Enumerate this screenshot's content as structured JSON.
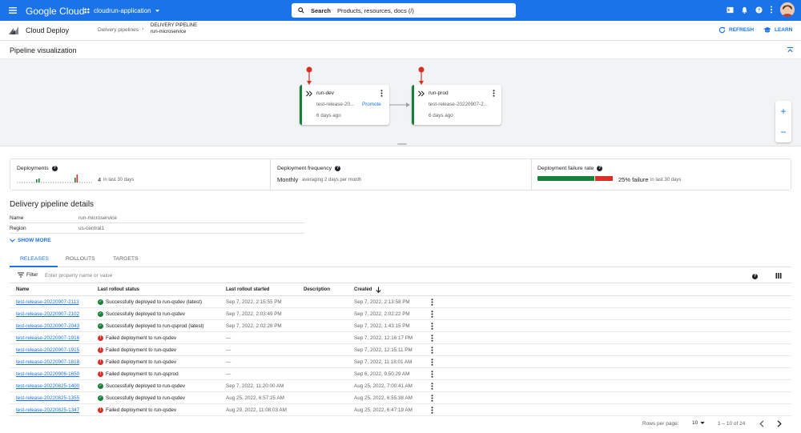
{
  "topbar": {
    "logo": "Google Cloud",
    "project": "cloudrun-application",
    "search_label": "Search",
    "search_placeholder": "Products, resources, docs (/)"
  },
  "header": {
    "product": "Cloud Deploy",
    "breadcrumb_parent": "Delivery pipelines",
    "breadcrumb_type": "DELIVERY PIPELINE",
    "breadcrumb_name": "run-microservice",
    "refresh": "REFRESH",
    "learn": "LEARN"
  },
  "viz": {
    "title": "Pipeline visualization",
    "stages": [
      {
        "name": "run-dev",
        "release": "test-release-20...",
        "ago": "6 days ago",
        "promote": "Promote"
      },
      {
        "name": "run-prod",
        "release": "test-release-20220907-2...",
        "ago": "6 days ago"
      }
    ],
    "zoom_in": "+",
    "zoom_out": "−"
  },
  "stats": {
    "deployments_label": "Deployments",
    "deployments_count": "4",
    "deployments_period": "in last 30 days",
    "frequency_label": "Deployment frequency",
    "frequency_value": "Monthly",
    "frequency_note": "averaging 2 days per month",
    "failure_label": "Deployment failure rate",
    "failure_value": "25% failure",
    "failure_period": "in last 30 days",
    "failure_rate": 0.25,
    "colors": {
      "success": "#188038",
      "failure": "#d93025"
    }
  },
  "details": {
    "title": "Delivery pipeline details",
    "name_key": "Name",
    "name_value": "run-microservice",
    "region_key": "Region",
    "region_value": "us-central1",
    "show_more": "SHOW MORE"
  },
  "tabs": [
    "RELEASES",
    "ROLLOUTS",
    "TARGETS"
  ],
  "filter": {
    "label": "Filter",
    "placeholder": "Enter property name or value"
  },
  "table": {
    "headers": {
      "name": "Name",
      "status": "Last rollout status",
      "started": "Last rollout started",
      "description": "Description",
      "created": "Created"
    },
    "rows": [
      {
        "name": "test-release-20220907-2113",
        "ok": true,
        "status": "Successfully deployed to run-qsdev (latest)",
        "started": "Sep 7, 2022, 2:15:55 PM",
        "created": "Sep 7, 2022, 2:13:58 PM"
      },
      {
        "name": "test-release-20220907-2102",
        "ok": true,
        "status": "Successfully deployed to run-qsdev",
        "started": "Sep 7, 2022, 2:03:49 PM",
        "created": "Sep 7, 2022, 2:02:22 PM"
      },
      {
        "name": "test-release-20220907-2043",
        "ok": true,
        "status": "Successfully deployed to run-qsprod (latest)",
        "started": "Sep 7, 2022, 2:02:28 PM",
        "created": "Sep 7, 2022, 1:43:15 PM"
      },
      {
        "name": "test-release-20220907-1916",
        "ok": false,
        "status": "Failed deployment to run-qsdev",
        "started": "—",
        "created": "Sep 7, 2022, 12:16:17 PM"
      },
      {
        "name": "test-release-20220907-1915",
        "ok": false,
        "status": "Failed deployment to run-qsdev",
        "started": "—",
        "created": "Sep 7, 2022, 12:15:11 PM"
      },
      {
        "name": "test-release-20220907-1818",
        "ok": false,
        "status": "Failed deployment to run-qsdev",
        "started": "—",
        "created": "Sep 7, 2022, 11:18:01 AM"
      },
      {
        "name": "test-release-20220906-1650",
        "ok": false,
        "status": "Failed deployment to run-qsprod",
        "started": "—",
        "created": "Sep 6, 2022, 9:50:29 AM"
      },
      {
        "name": "test-release-20220825-1400",
        "ok": true,
        "status": "Successfully deployed to run-qsdev",
        "started": "Sep 7, 2022, 11:20:00 AM",
        "created": "Aug 25, 2022, 7:00:41 AM"
      },
      {
        "name": "test-release-20220825-1355",
        "ok": true,
        "status": "Successfully deployed to run-qsdev",
        "started": "Aug 25, 2022, 6:57:25 AM",
        "created": "Aug 25, 2022, 6:55:38 AM"
      },
      {
        "name": "test-release-20220825-1347",
        "ok": false,
        "status": "Failed deployment to run-qsdev",
        "started": "Aug 29, 2022, 11:08:03 AM",
        "created": "Aug 25, 2022, 6:47:19 AM"
      }
    ]
  },
  "pager": {
    "rows_label": "Rows per page:",
    "rows_value": "10",
    "range": "1 – 10 of 24"
  }
}
